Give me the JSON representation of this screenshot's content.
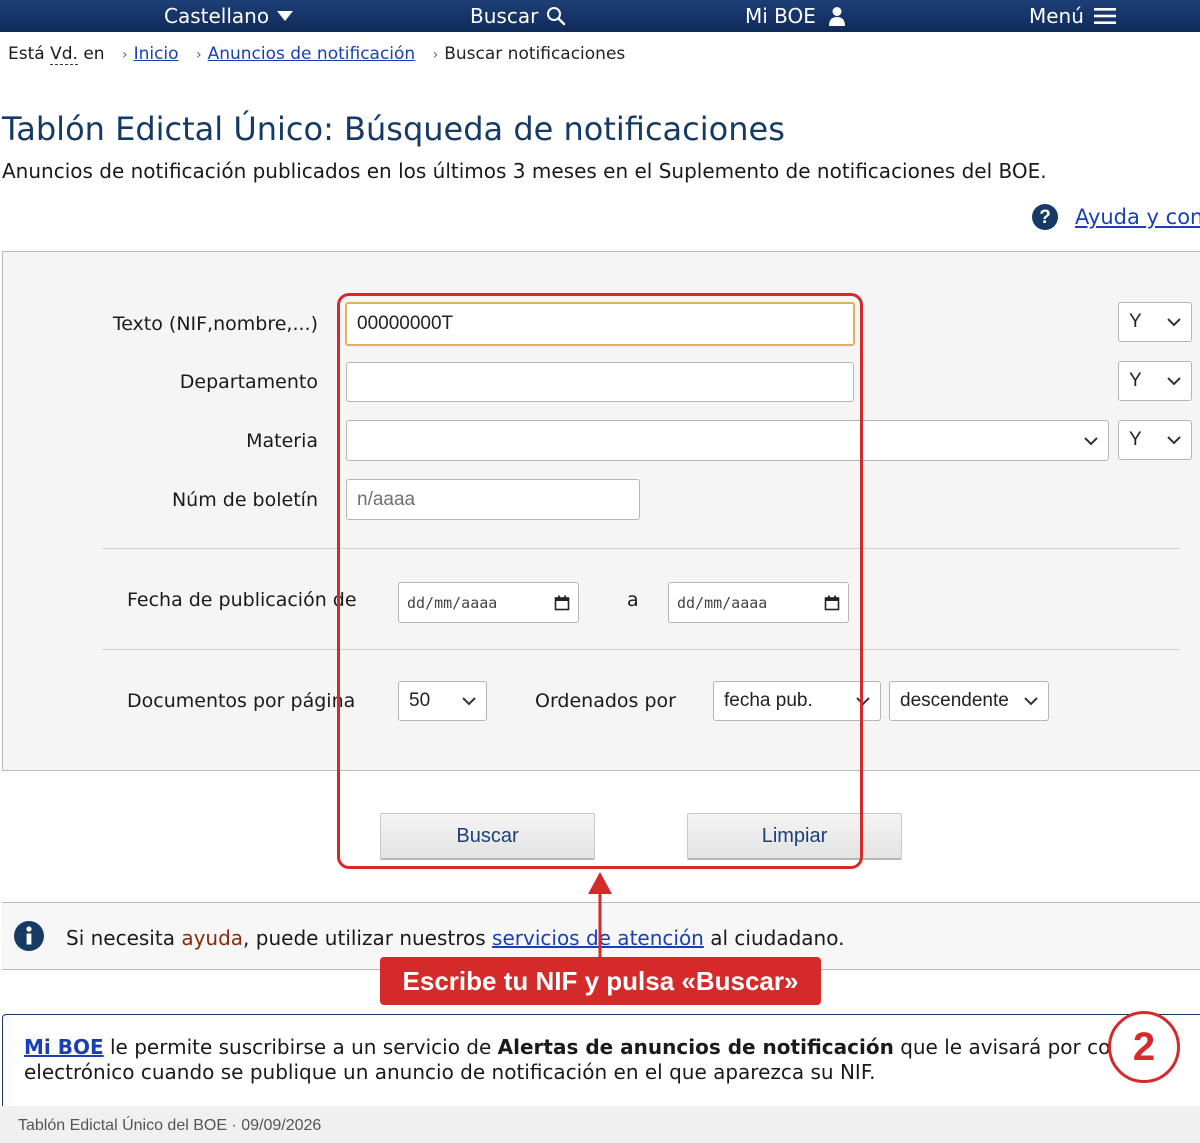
{
  "topnav": {
    "language": "Castellano",
    "search": "Buscar",
    "account": "Mi BOE",
    "menu": "Menú"
  },
  "breadcrumb": {
    "prefix_a": "Está",
    "prefix_abbr": "Vd.",
    "prefix_b": "en",
    "home": "Inicio",
    "section": "Anuncios de notificación",
    "current": "Buscar notificaciones"
  },
  "page": {
    "title": "Tablón Edictal Único: Búsqueda de notificaciones",
    "subtitle": "Anuncios de notificación publicados en los últimos 3 meses en el Suplemento de notificaciones del BOE.",
    "help_link": "Ayuda y con"
  },
  "form": {
    "text_label": "Texto (NIF,nombre,...)",
    "text_value": "00000000T",
    "dept_label": "Departamento",
    "dept_value": "",
    "materia_label": "Materia",
    "materia_value": "",
    "boletin_label": "Núm de boletín",
    "boletin_placeholder": "n/aaaa",
    "operator": "Y",
    "date_label": "Fecha de publicación de",
    "date_from_placeholder": "dd/mm/aaaa",
    "date_sep": "a",
    "date_to_placeholder": "dd/mm/aaaa",
    "docs_label": "Documentos por página",
    "docs_value": "50",
    "order_label": "Ordenados por",
    "order_field": "fecha pub.",
    "order_dir": "descendente",
    "search_button": "Buscar",
    "clear_button": "Limpiar"
  },
  "info": {
    "pre": "Si necesita",
    "highlight": "ayuda",
    "mid": ", puede utilizar nuestros",
    "link": "servicios de atención",
    "post": "al ciudadano."
  },
  "mib": {
    "link": "Mi BOE",
    "t1": "le permite suscribirse a un servicio de",
    "bold": "Alertas de anuncios de notificación",
    "t2": "que le avisará por correo",
    "t3": "electrónico cuando se publique un anuncio de notificación en el que aparezca su NIF."
  },
  "callout": {
    "label": "Escribe tu NIF y pulsa «Buscar»",
    "step": "2"
  },
  "footer": {
    "text": "Tablón Edictal Único del BOE · 09/09/2026"
  },
  "colors": {
    "nav": "#0f2a57",
    "title": "#163a66",
    "link": "#1a3fb5",
    "callout": "#d42a2a",
    "focus": "#e0b05c"
  }
}
